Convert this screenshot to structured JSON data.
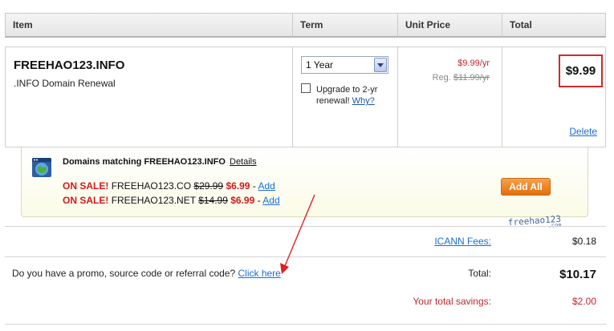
{
  "table_header": {
    "item": "Item",
    "term": "Term",
    "unit_price": "Unit Price",
    "total": "Total"
  },
  "item": {
    "domain": "FREEHAO123.INFO",
    "description": ".INFO Domain Renewal",
    "term_selected": "1 Year",
    "upgrade_text": "Upgrade to 2-yr renewal!",
    "upgrade_why": "Why?",
    "unit_price": "$9.99/yr",
    "reg_label": "Reg.",
    "reg_price": "$11.99/yr",
    "total": "$9.99",
    "delete_label": "Delete"
  },
  "matching": {
    "title": "Domains matching FREEHAO123.INFO",
    "details_label": "Details",
    "on_sale_label": "ON SALE!",
    "offers": [
      {
        "domain": "FREEHAO123.CO",
        "old_price": "$29.99",
        "new_price": "$6.99",
        "add_label": "Add"
      },
      {
        "domain": "FREEHAO123.NET",
        "old_price": "$14.99",
        "new_price": "$6.99",
        "add_label": "Add"
      }
    ],
    "add_all_label": "Add All"
  },
  "watermark": {
    "text": "freehao123",
    "suffix": ".com"
  },
  "summary": {
    "icann_fees_label": "ICANN Fees:",
    "icann_fees_value": "$0.18",
    "promo_question": "Do you have a promo, source code or referral code?",
    "promo_link": "Click here",
    "total_label": "Total:",
    "total_value": "$10.17",
    "savings_label": "Your total savings:",
    "savings_value": "$2.00"
  },
  "colors": {
    "link": "#1a6ed4",
    "sale_red": "#d11a1a",
    "price_red": "#c0262d",
    "highlight_box": "#d22a2a",
    "button_orange": "#e46f0c",
    "annotation_arrow": "#e02020"
  },
  "icons": {
    "globe": "globe-window-icon",
    "dropdown": "chevron-down-icon",
    "annotation": "red-arrow-annotation"
  }
}
